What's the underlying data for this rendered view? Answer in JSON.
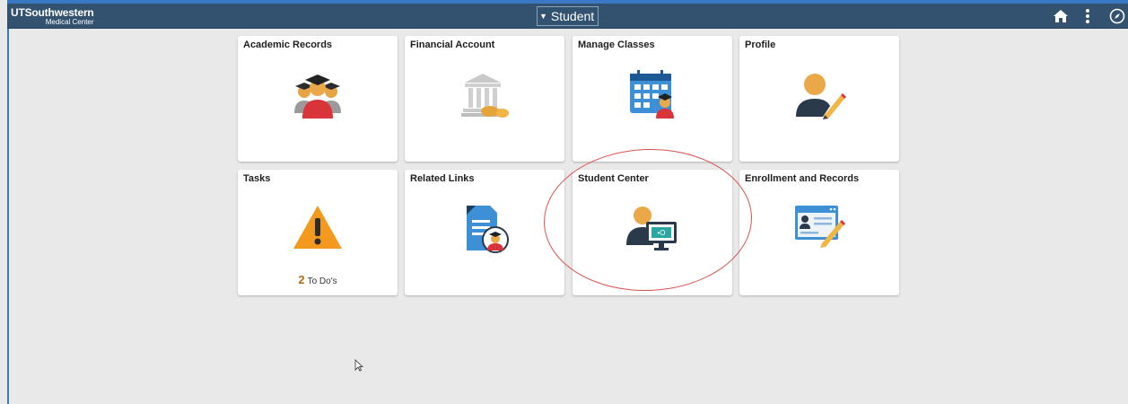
{
  "header": {
    "logo_main": "UTSouthwestern",
    "logo_sub": "Medical Center",
    "title": "Student",
    "bg_color": "#33526f"
  },
  "tiles": [
    {
      "title": "Academic Records",
      "icon": "graduates-icon"
    },
    {
      "title": "Financial Account",
      "icon": "bank-coins-icon"
    },
    {
      "title": "Manage Classes",
      "icon": "calendar-student-icon"
    },
    {
      "title": "Profile",
      "icon": "user-edit-icon"
    },
    {
      "title": "Tasks",
      "icon": "warning-icon",
      "count": "2",
      "count_label": "To Do's"
    },
    {
      "title": "Related Links",
      "icon": "document-student-icon"
    },
    {
      "title": "Student Center",
      "icon": "student-computer-icon"
    },
    {
      "title": "Enrollment and Records",
      "icon": "form-edit-icon"
    }
  ],
  "colors": {
    "accent": "#33526f",
    "annotation": "#d9534f",
    "warning": "#f39a1e"
  }
}
